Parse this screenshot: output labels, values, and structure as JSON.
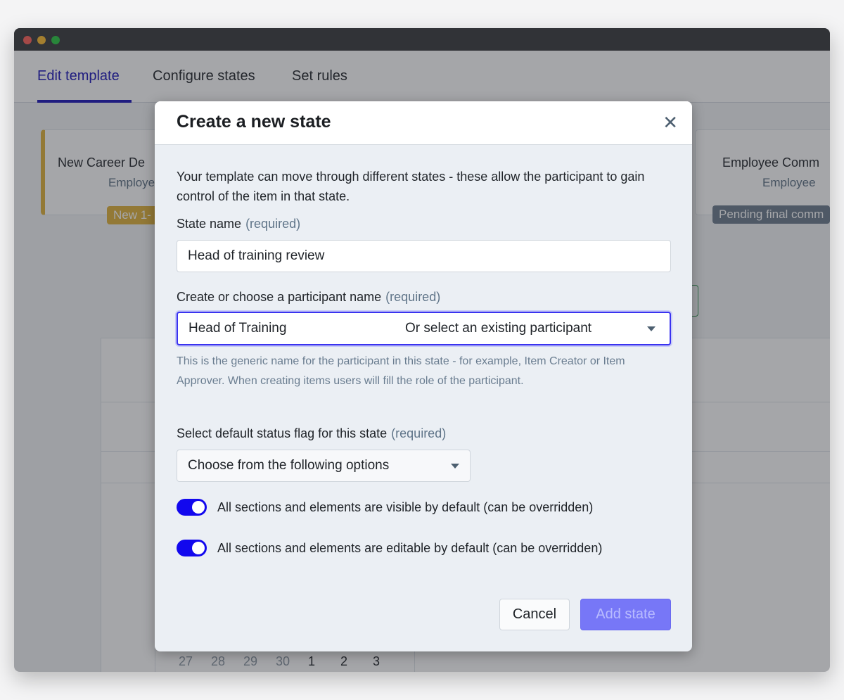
{
  "window": {
    "controls": {
      "close_color": "#ff5f57",
      "minimize_color": "#febc2e",
      "maximize_color": "#28c840"
    }
  },
  "tabs": [
    {
      "label": "Edit template",
      "active": true
    },
    {
      "label": "Configure states",
      "active": false
    },
    {
      "label": "Set rules",
      "active": false
    }
  ],
  "background": {
    "cards": [
      {
        "title": "New Career De",
        "participant": "Employe",
        "badge": "New 1-",
        "accent": "#e0b23a"
      },
      {
        "title": "Employee Comm",
        "participant": "Employee",
        "badge": "Pending final comm",
        "accent": "#6b7b8c"
      }
    ],
    "calendar_days": [
      {
        "d": "27",
        "muted": true
      },
      {
        "d": "28",
        "muted": true
      },
      {
        "d": "29",
        "muted": true
      },
      {
        "d": "30",
        "muted": true
      },
      {
        "d": "1",
        "muted": false
      },
      {
        "d": "2",
        "muted": false
      },
      {
        "d": "3",
        "muted": false
      }
    ]
  },
  "modal": {
    "title": "Create a new state",
    "close_icon": "close-icon",
    "intro": "Your template can move through different states - these allow the participant to gain control of the item in that state.",
    "state_name": {
      "label": "State name",
      "required": "(required)",
      "value": "Head of training review"
    },
    "participant": {
      "label": "Create or choose a participant name",
      "required": "(required)",
      "value": "Head of Training",
      "select_placeholder": "Or select an existing participant",
      "help": "This is the generic name for the participant in this state - for example, Item Creator or Item Approver. When creating items users will fill the role of the participant."
    },
    "status_flag": {
      "label": "Select default status flag for this state",
      "required": "(required)",
      "placeholder": "Choose from the following options"
    },
    "toggles": [
      {
        "label": "All sections and elements are visible by default (can be overridden)",
        "on": true
      },
      {
        "label": "All sections and elements are editable by default (can be overridden)",
        "on": true
      }
    ],
    "cancel_label": "Cancel",
    "submit_label": "Add state",
    "accent": "#1208ee"
  }
}
